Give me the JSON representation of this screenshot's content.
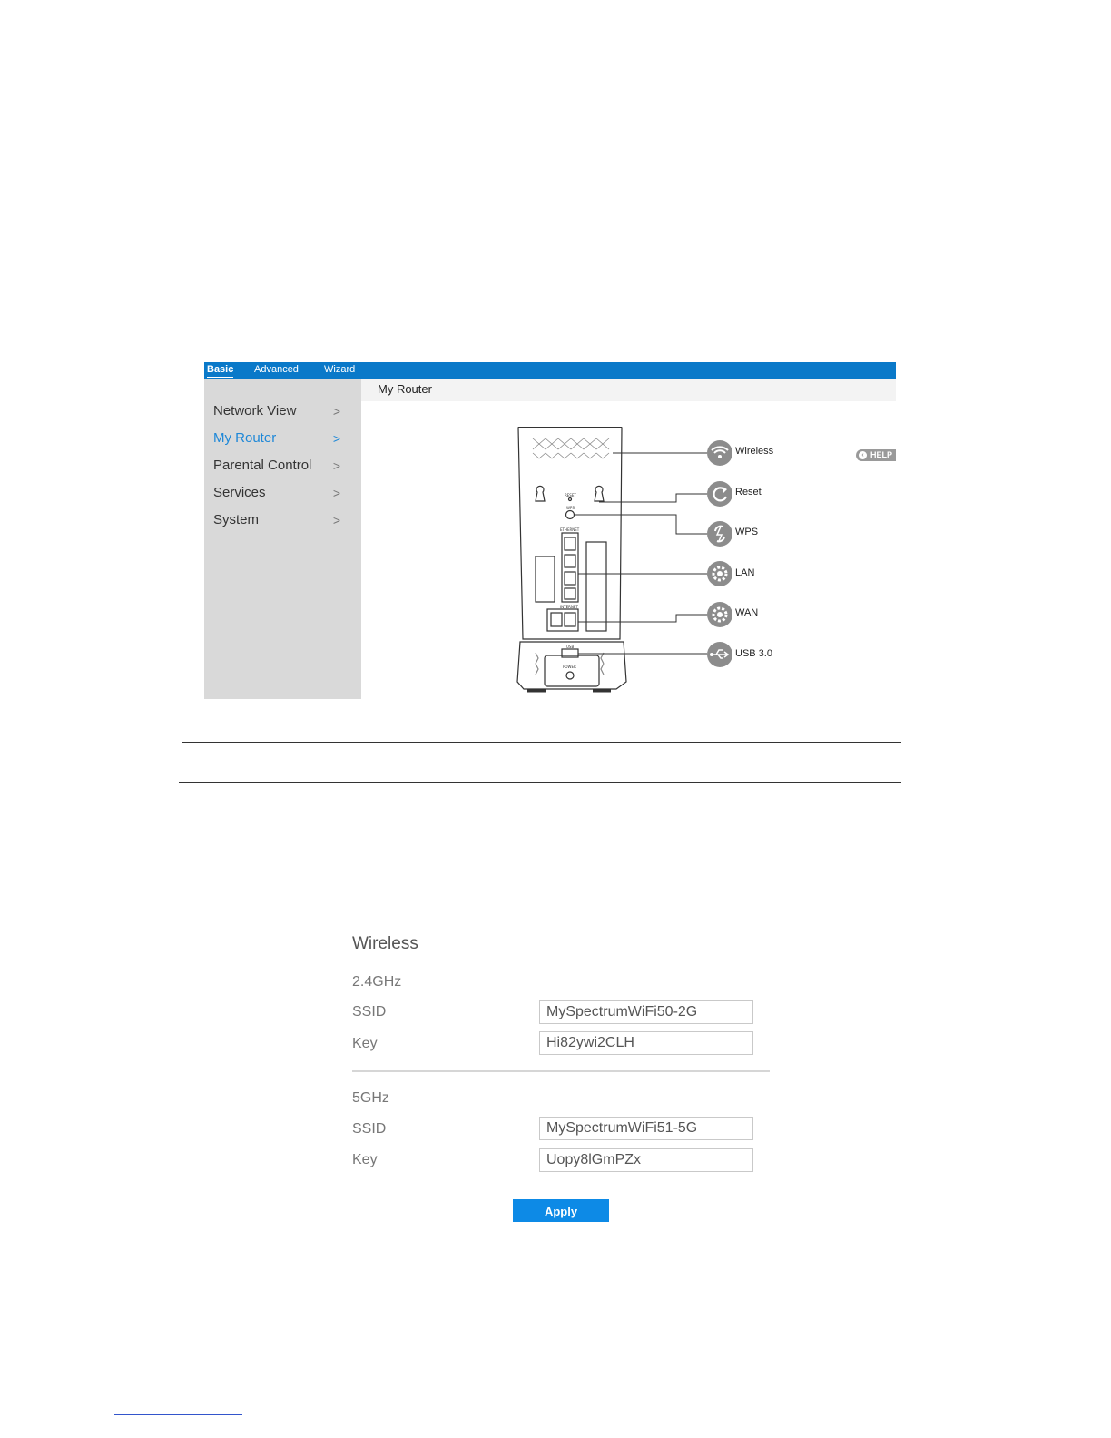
{
  "top_nav": {
    "tabs": [
      "Basic",
      "Advanced",
      "Wizard"
    ],
    "active": "Basic"
  },
  "sidebar": {
    "items": [
      {
        "label": "Network View",
        "chevron": ">"
      },
      {
        "label": "My Router",
        "chevron": ">",
        "active": true
      },
      {
        "label": "Parental Control",
        "chevron": ">"
      },
      {
        "label": "Services",
        "chevron": ">"
      },
      {
        "label": "System",
        "chevron": ">"
      }
    ]
  },
  "content": {
    "header": "My Router",
    "help_label": "HELP",
    "callouts": [
      {
        "label": "Wireless",
        "icon": "wifi-icon"
      },
      {
        "label": "Reset",
        "icon": "reset-icon"
      },
      {
        "label": "WPS",
        "icon": "wps-icon"
      },
      {
        "label": "LAN",
        "icon": "gear-icon"
      },
      {
        "label": "WAN",
        "icon": "gear-icon"
      },
      {
        "label": "USB 3.0",
        "icon": "usb-icon"
      }
    ],
    "device_labels": {
      "reset": "RESET",
      "wps": "WPS",
      "ethernet": "ETHERNET",
      "internet": "INTERNET",
      "usb": "USB",
      "power": "POWER"
    }
  },
  "wireless": {
    "title": "Wireless",
    "bands": [
      {
        "name": "2.4GHz",
        "ssid_label": "SSID",
        "ssid": "MySpectrumWiFi50-2G",
        "key_label": "Key",
        "key": "Hi82ywi2CLH"
      },
      {
        "name": "5GHz",
        "ssid_label": "SSID",
        "ssid": "MySpectrumWiFi51-5G",
        "key_label": "Key",
        "key": "Uopy8lGmPZx"
      }
    ],
    "apply_label": "Apply"
  },
  "colors": {
    "nav_blue": "#0a79c9",
    "active_link": "#1e88d8",
    "apply_blue": "#0d8ae6",
    "callout_gray": "#8c8c8c"
  }
}
